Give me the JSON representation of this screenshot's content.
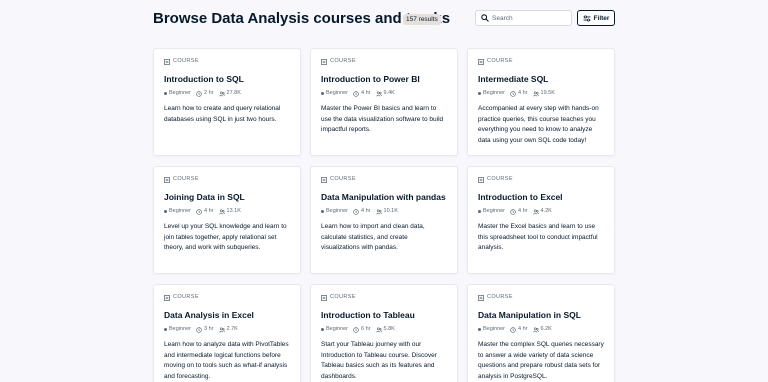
{
  "page": {
    "title": "Browse Data Analysis courses and tracks",
    "results_count": "157 results",
    "search_placeholder": "Search",
    "filter_label": "Filter"
  },
  "icons": {
    "search": "search-icon",
    "filter": "filter-sliders-icon",
    "course": "course-icon",
    "time": "clock-icon",
    "participants": "people-icon"
  },
  "colors": {
    "text": "#05192d",
    "muted": "#5d6a77",
    "background": "#f7f7fc",
    "card": "#ffffff",
    "badge": "#e5e1da"
  },
  "cards": [
    {
      "type": "COURSE",
      "title": "Introduction to SQL",
      "level": "Beginner",
      "duration": "2 hr",
      "participants": "27.8K",
      "description": "Learn how to create and query relational databases using SQL in just two hours."
    },
    {
      "type": "COURSE",
      "title": "Introduction to Power BI",
      "level": "Beginner",
      "duration": "4 hr",
      "participants": "9.4K",
      "description": "Master the Power BI basics and learn to use the data visualization software to build impactful reports."
    },
    {
      "type": "COURSE",
      "title": "Intermediate SQL",
      "level": "Beginner",
      "duration": "4 hr",
      "participants": "19.5K",
      "description": "Accompanied at every step with hands-on practice queries, this course teaches you everything you need to know to analyze data using your own SQL code today!"
    },
    {
      "type": "COURSE",
      "title": "Joining Data in SQL",
      "level": "Beginner",
      "duration": "4 hr",
      "participants": "13.1K",
      "description": "Level up your SQL knowledge and learn to join tables together, apply relational set theory, and work with subqueries."
    },
    {
      "type": "COURSE",
      "title": "Data Manipulation with pandas",
      "level": "Beginner",
      "duration": "4 hr",
      "participants": "10.1K",
      "description": "Learn how to import and clean data, calculate statistics, and create visualizations with pandas."
    },
    {
      "type": "COURSE",
      "title": "Introduction to Excel",
      "level": "Beginner",
      "duration": "4 hr",
      "participants": "4.2K",
      "description": "Master the Excel basics and learn to use this spreadsheet tool to conduct impactful analysis."
    },
    {
      "type": "COURSE",
      "title": "Data Analysis in Excel",
      "level": "Beginner",
      "duration": "3 hr",
      "participants": "2.7K",
      "description": "Learn how to analyze data with PivotTables and intermediate logical functions before moving on to tools such as what-if analysis and forecasting."
    },
    {
      "type": "COURSE",
      "title": "Introduction to Tableau",
      "level": "Beginner",
      "duration": "6 hr",
      "participants": "5.8K",
      "description": "Start your Tableau journey with our Introduction to Tableau course. Discover Tableau basics such as its features and dashboards."
    },
    {
      "type": "COURSE",
      "title": "Data Manipulation in SQL",
      "level": "Beginner",
      "duration": "4 hr",
      "participants": "6.2K",
      "description": "Master the complex SQL queries necessary to answer a wide variety of data science questions and prepare robust data sets for analysis in PostgreSQL."
    }
  ]
}
